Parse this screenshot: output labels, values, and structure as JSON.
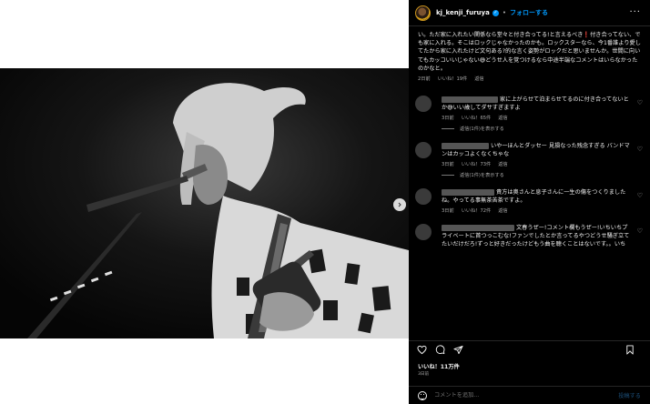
{
  "post": {
    "username": "kj_kenji_furuya",
    "follow_label": "フォローする",
    "more_icon": "more-horizontal-icon"
  },
  "caption": {
    "text": "い。ただ家に入れたい関係なら堂々と付き合ってる!と言えるべき❗️付き合ってない、でも家に入れる。そこはロックじゃなかったのかも。ロックスターなら、今1番誰より愛してたから家に入れたけど文句ある?的な言く姿勢がロックだと思いませんか。世間に向いてもカッコいいじゃない😅どうせ人を覚つけるなら中途半端なコメントはいらなかったのかなと。",
    "meta_time": "2日前",
    "meta_likes": "いいね！19件",
    "meta_reply": "返信"
  },
  "comments": [
    {
      "text": "家に上がらせて泊まらせてるのに付き合ってないとか😅いい歳してダサすぎますよ",
      "time": "3日前",
      "likes": "いいね！65件",
      "reply": "返信",
      "replies_label": "返信(1件)を表示する"
    },
    {
      "text": "いや一ほんとダッセー 見損なった残念すぎる バンドマンはカッコよくなくちゃな",
      "time": "3日前",
      "likes": "いいね！73件",
      "reply": "返信",
      "replies_label": "返信(1件)を表示する"
    },
    {
      "text": "貴方は奥さんと息子さんに一生の傷をつくりましたね。やってる事無茶苦茶ですよ。",
      "time": "3日前",
      "likes": "いいね！72件",
      "reply": "返信",
      "replies_label": ""
    },
    {
      "text": "文春うぜー!コメント欄もうぜー!いちいちプライベートに首つっこむな!ファンでしたとか言ってるやつどうせ騒ぎ立てたいだけだろ!ずっと好きだったけどもう曲を聴くことはないです。。いち",
      "time": "",
      "likes": "",
      "reply": "",
      "replies_label": ""
    }
  ],
  "footer": {
    "likes": "いいね！11万件",
    "date": "3日前",
    "comment_placeholder": "コメントを追加...",
    "post_label": "投稿する"
  },
  "colors": {
    "panel_bg": "#000000",
    "accent": "#0095f6",
    "muted": "#a8a8a8"
  }
}
